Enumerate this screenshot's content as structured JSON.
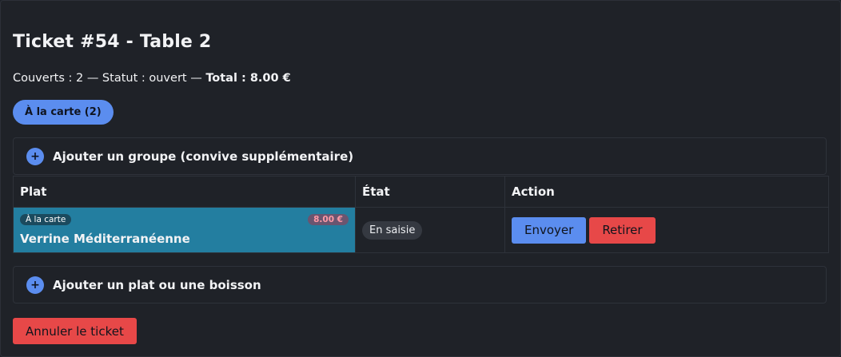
{
  "ticket": {
    "title": "Ticket #54 - Table 2",
    "meta_text": "Couverts : 2 — Statut : ouvert — ",
    "total_label": "Total : 8.00 €"
  },
  "filter_pill": "À la carte (2)",
  "add_group": {
    "icon": "plus-icon",
    "label": "Ajouter un groupe (convive supplémentaire)"
  },
  "table": {
    "headers": [
      "Plat",
      "État",
      "Action"
    ],
    "rows": [
      {
        "tag": "À la carte",
        "price": "8.00 €",
        "dish": "Verrine Méditerranéenne",
        "state": "En saisie",
        "actions": [
          "Envoyer",
          "Retirer"
        ]
      }
    ]
  },
  "add_item": {
    "icon": "plus-icon",
    "label": "Ajouter un plat ou une boisson"
  },
  "cancel_button": "Annuler le ticket",
  "colors": {
    "background": "#1f2228",
    "accent": "#5b8def",
    "danger": "#e74848",
    "row_highlight": "#237ea0"
  }
}
